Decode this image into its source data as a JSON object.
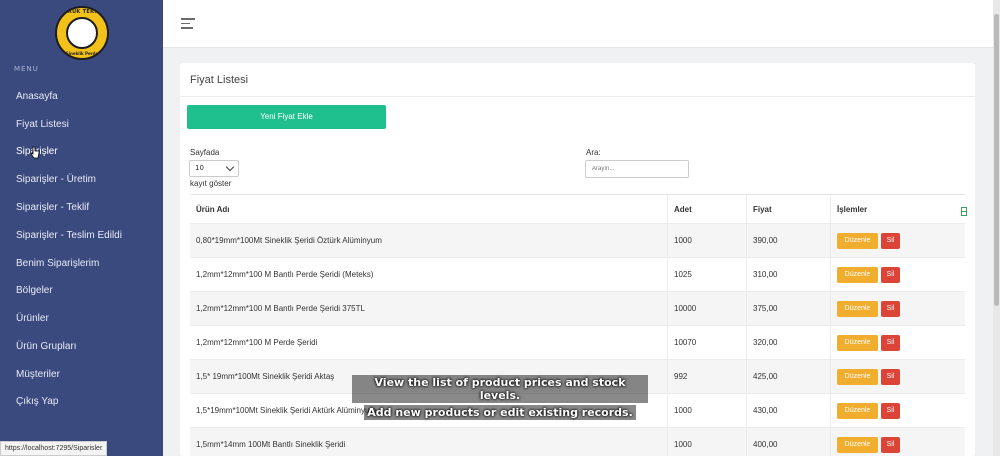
{
  "logo": {
    "top_text": "DORUK TEKNIK",
    "bottom_text": "Sineklik Perde"
  },
  "sidebar": {
    "menu_label": "MENU",
    "items": [
      {
        "label": "Anasayfa"
      },
      {
        "label": "Fiyat Listesi"
      },
      {
        "label": "Siparişler"
      },
      {
        "label": "Siparişler - Üretim"
      },
      {
        "label": "Siparişler - Teklif"
      },
      {
        "label": "Siparişler - Teslim Edildi"
      },
      {
        "label": "Benim Siparişlerim"
      },
      {
        "label": "Bölgeler"
      },
      {
        "label": "Ürünler"
      },
      {
        "label": "Ürün Grupları"
      },
      {
        "label": "Müşteriler"
      },
      {
        "label": "Çıkış Yap"
      }
    ]
  },
  "card": {
    "title": "Fiyat Listesi",
    "new_button": "Yeni Fiyat Ekle",
    "length_label": "Sayfada",
    "length_value": "10",
    "length_suffix": "kayıt göster",
    "search_label": "Ara:",
    "search_placeholder": "Arayın..."
  },
  "table": {
    "headers": [
      "Ürün Adı",
      "Adet",
      "Fiyat",
      "İşlemler"
    ],
    "edit_label": "Düzenle",
    "delete_label": "Sil",
    "rows": [
      {
        "name": "0,80*19mm*100Mt Sineklik Şeridi Öztürk Alüminyum",
        "qty": "1000",
        "price": "390,00"
      },
      {
        "name": "1,2mm*12mm*100 M Bantlı Perde Şeridi (Meteks)",
        "qty": "1025",
        "price": "310,00"
      },
      {
        "name": "1,2mm*12mm*100 M Bantlı Perde Şeridi 375TL",
        "qty": "10000",
        "price": "375,00"
      },
      {
        "name": "1,2mm*12mm*100 M Perde Şeridi",
        "qty": "10070",
        "price": "320,00"
      },
      {
        "name": "1,5* 19mm*100Mt Sineklik Şeridi Aktaş",
        "qty": "992",
        "price": "425,00"
      },
      {
        "name": "1,5*19mm*100Mt Sineklik Şeridi Aktürk Alüminyum",
        "qty": "1000",
        "price": "430,00"
      },
      {
        "name": "1,5mm*14mm 100Mt Bantlı Sineklik Şeridi",
        "qty": "1000",
        "price": "400,00"
      }
    ]
  },
  "caption": {
    "line1": "View the list of product prices and stock levels.",
    "line2": "Add new products or edit existing records."
  },
  "status_url": "https://localhost:7295/Siparisler"
}
